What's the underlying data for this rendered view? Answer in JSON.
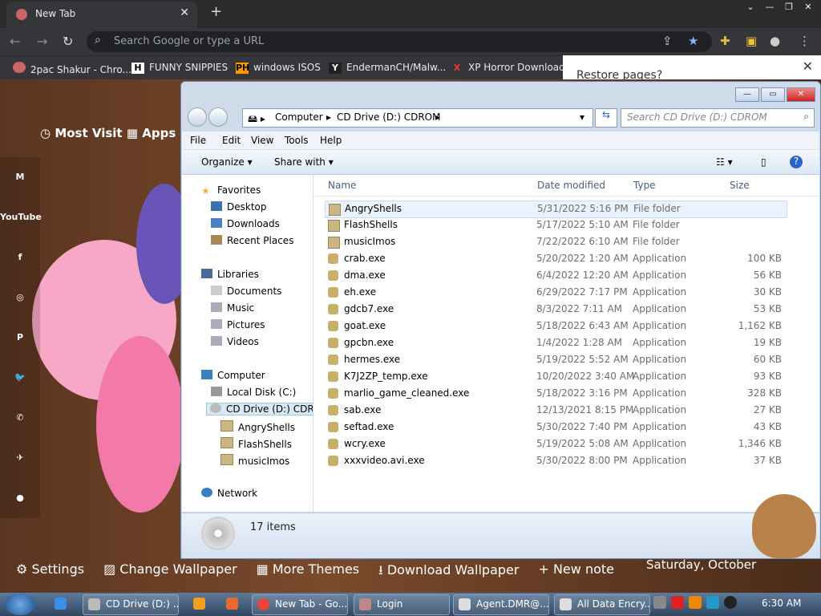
{
  "browser": {
    "tab_title": "New Tab",
    "omnibox_placeholder": "Search Google or type a URL",
    "bookmarks": [
      {
        "icon": "",
        "label": "2pac Shakur - Chro..."
      },
      {
        "icon": "H",
        "label": "FUNNY SNIPPIES"
      },
      {
        "icon": "PH",
        "label": "windows ISOS"
      },
      {
        "icon": "Y",
        "label": "EndermanCH/Malw..."
      },
      {
        "icon": "X",
        "label": "XP Horror Download"
      }
    ],
    "restore_text": "Restore pages?"
  },
  "newtab": {
    "most_visited": "Most Visit",
    "apps": "Apps",
    "social": [
      "M",
      "YouTube",
      "f",
      "◎",
      "P",
      "🐦",
      "✆",
      "✈",
      "●"
    ],
    "bottom_links": [
      "Settings",
      "Change Wallpaper",
      "More Themes",
      "Download Wallpaper",
      "+ New note"
    ],
    "date": "Saturday, October"
  },
  "explorer": {
    "path": [
      "Computer",
      "CD Drive (D:) CDROM"
    ],
    "search_placeholder": "Search CD Drive (D:) CDROM",
    "menu": [
      "File",
      "Edit",
      "View",
      "Tools",
      "Help"
    ],
    "commands": {
      "organize": "Organize",
      "share": "Share with"
    },
    "nav": {
      "favorites": "Favorites",
      "fav_items": [
        "Desktop",
        "Downloads",
        "Recent Places"
      ],
      "libraries": "Libraries",
      "lib_items": [
        "Documents",
        "Music",
        "Pictures",
        "Videos"
      ],
      "computer": "Computer",
      "comp_items": [
        "Local Disk (C:)",
        "CD Drive (D:) CDROM"
      ],
      "cd_folders": [
        "AngryShells",
        "FlashShells",
        "musicImos"
      ],
      "network": "Network"
    },
    "columns": {
      "name": "Name",
      "date": "Date modified",
      "type": "Type",
      "size": "Size"
    },
    "files": [
      {
        "name": "AngryShells",
        "date": "5/31/2022 5:16 PM",
        "type": "File folder",
        "size": ""
      },
      {
        "name": "FlashShells",
        "date": "5/17/2022 5:10 AM",
        "type": "File folder",
        "size": ""
      },
      {
        "name": "musicImos",
        "date": "7/22/2022 6:10 AM",
        "type": "File folder",
        "size": ""
      },
      {
        "name": "crab.exe",
        "date": "5/20/2022 1:20 AM",
        "type": "Application",
        "size": "100 KB"
      },
      {
        "name": "dma.exe",
        "date": "6/4/2022 12:20 AM",
        "type": "Application",
        "size": "56 KB"
      },
      {
        "name": "eh.exe",
        "date": "6/29/2022 7:17 PM",
        "type": "Application",
        "size": "30 KB"
      },
      {
        "name": "gdcb7.exe",
        "date": "8/3/2022 7:11 AM",
        "type": "Application",
        "size": "53 KB"
      },
      {
        "name": "goat.exe",
        "date": "5/18/2022 6:43 AM",
        "type": "Application",
        "size": "1,162 KB"
      },
      {
        "name": "gpcbn.exe",
        "date": "1/4/2022 1:28 AM",
        "type": "Application",
        "size": "19 KB"
      },
      {
        "name": "hermes.exe",
        "date": "5/19/2022 5:52 AM",
        "type": "Application",
        "size": "60 KB"
      },
      {
        "name": "K7J2ZP_temp.exe",
        "date": "10/20/2022 3:40 AM",
        "type": "Application",
        "size": "93 KB"
      },
      {
        "name": "marlio_game_cleaned.exe",
        "date": "5/18/2022 3:16 PM",
        "type": "Application",
        "size": "328 KB"
      },
      {
        "name": "sab.exe",
        "date": "12/13/2021 8:15 PM",
        "type": "Application",
        "size": "27 KB"
      },
      {
        "name": "seftad.exe",
        "date": "5/30/2022 7:40 PM",
        "type": "Application",
        "size": "43 KB"
      },
      {
        "name": "wcry.exe",
        "date": "5/19/2022 5:08 AM",
        "type": "Application",
        "size": "1,346 KB"
      },
      {
        "name": "xxxvideo.avi.exe",
        "date": "5/30/2022 8:00 PM",
        "type": "Application",
        "size": "37 KB"
      }
    ],
    "status": "17 items"
  },
  "taskbar": {
    "buttons": [
      "CD Drive (D:) ...",
      "New Tab - Go...",
      "Login",
      "Agent.DMR@...",
      "All Data Encry..."
    ],
    "clock": "6:30 AM"
  }
}
